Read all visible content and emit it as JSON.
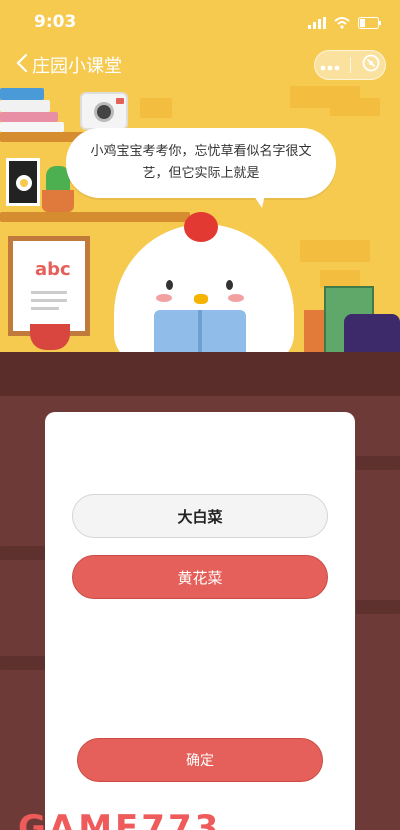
{
  "status_bar": {
    "time": "9:03"
  },
  "nav": {
    "back_label": "庄园小课堂"
  },
  "question": {
    "text": "小鸡宝宝考考你，忘忧草看似名字很文艺，但它实际上就是"
  },
  "options": [
    {
      "label": "大白菜"
    },
    {
      "label": "黄花菜"
    }
  ],
  "confirm_label": "确定",
  "illustration": {
    "poster_text": "abc"
  },
  "watermark": {
    "text": "GAME773"
  },
  "colors": {
    "sky": "#f6c94f",
    "wall": "#6e3a37",
    "button_red": "#e5605a",
    "card": "#ffffff"
  }
}
